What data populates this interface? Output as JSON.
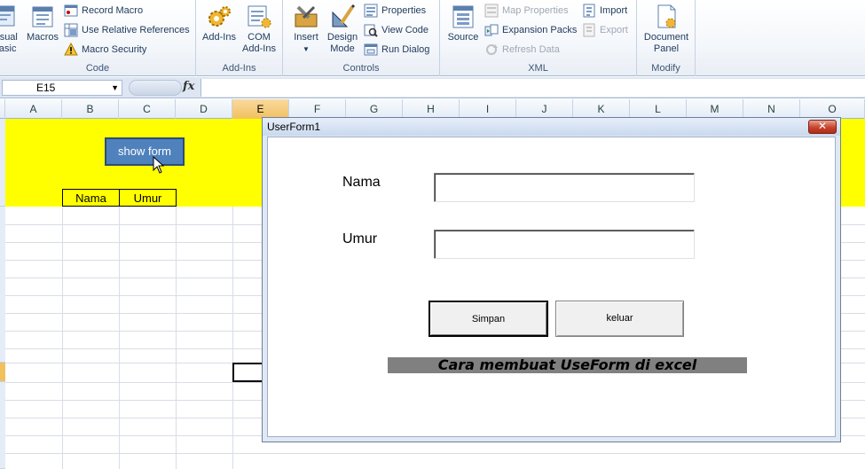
{
  "ribbon": {
    "code": {
      "label": "Code",
      "visual_basic": "Visual\nBasic",
      "macros": "Macros",
      "record_macro": "Record Macro",
      "relative_refs": "Use Relative References",
      "macro_security": "Macro Security"
    },
    "addins": {
      "label": "Add-Ins",
      "addins": "Add-Ins",
      "com_addins": "COM\nAdd-Ins"
    },
    "controls": {
      "label": "Controls",
      "insert": "Insert",
      "design_mode": "Design\nMode",
      "properties": "Properties",
      "view_code": "View Code",
      "run_dialog": "Run Dialog"
    },
    "xml": {
      "label": "XML",
      "source": "Source",
      "map_properties": "Map Properties",
      "expansion_packs": "Expansion Packs",
      "refresh_data": "Refresh Data",
      "import": "Import",
      "export": "Export"
    },
    "modify": {
      "label": "Modify",
      "document_panel": "Document\nPanel"
    }
  },
  "formula_bar": {
    "name_box": "E15",
    "fx": "fx",
    "formula": ""
  },
  "columns": [
    "A",
    "B",
    "C",
    "D",
    "E",
    "F",
    "G",
    "H",
    "I",
    "J",
    "K",
    "L",
    "M",
    "N",
    "O"
  ],
  "sheet": {
    "show_form_button": "show form",
    "header_cells": [
      "Nama",
      "Umur"
    ]
  },
  "userform": {
    "title": "UserForm1",
    "close": "✕",
    "label_nama": "Nama",
    "label_umur": "Umur",
    "nama_value": "",
    "umur_value": "",
    "simpan": "Simpan",
    "keluar": "keluar",
    "banner": "Cara membuat UseForm di excel"
  },
  "colors": {
    "sheet_highlight": "#ffff00",
    "button_blue": "#4f81bd",
    "selected_header": "#f1c15f"
  }
}
